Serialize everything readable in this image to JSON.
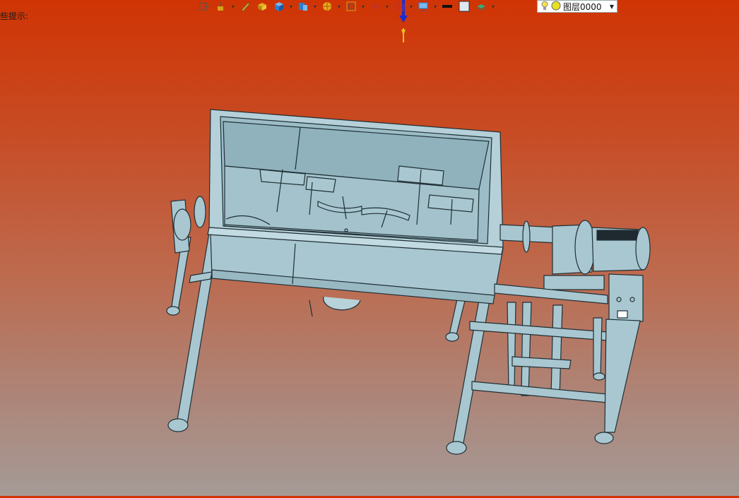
{
  "status": {
    "hint_text": "些提示:"
  },
  "toolbar": {
    "buttons": [
      {
        "name": "exit-sketch-icon",
        "color": "#555555",
        "dropdown": false
      },
      {
        "name": "extrude-icon",
        "color": "#d6a21a",
        "dropdown": true
      },
      {
        "name": "pen-icon",
        "color": "#d6a21a",
        "dropdown": false
      },
      {
        "name": "solid-box-icon",
        "color": "#e0b020",
        "dropdown": false
      },
      {
        "name": "cube-icon",
        "color": "#2a7fd4",
        "dropdown": true
      },
      {
        "name": "shell-icon",
        "color": "#2a7fd4",
        "dropdown": true
      },
      {
        "name": "pattern-icon",
        "color": "#e8a818",
        "dropdown": true
      },
      {
        "name": "zoom-icon",
        "color": "#d6a21a",
        "dropdown": true
      },
      {
        "name": "move-icon",
        "color": "#c23030",
        "dropdown": true
      },
      {
        "name": "measure-icon",
        "color": "#c23030",
        "dropdown": true
      },
      {
        "name": "display-icon",
        "color": "#2a7fd4",
        "dropdown": true
      },
      {
        "name": "line-color-icon",
        "color": "#111111",
        "dropdown": false
      },
      {
        "name": "fill-color-icon",
        "color": "#dfe8f2",
        "dropdown": false
      },
      {
        "name": "layer-icon",
        "color": "#3aa878",
        "dropdown": true
      }
    ]
  },
  "layer": {
    "current": "图层0000",
    "bulb_color": "#f5e050"
  },
  "viewport": {
    "background_top": "#d03404",
    "background_bottom": "#a59a96",
    "model_color": "#a9c7d0",
    "edge_color": "#1f2f35"
  }
}
